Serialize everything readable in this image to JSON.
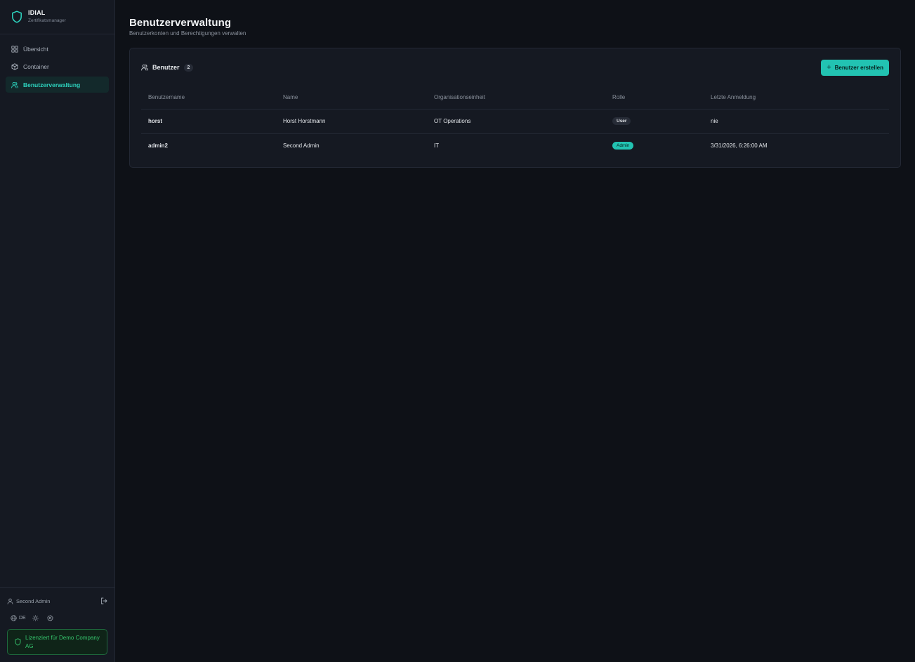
{
  "brand": {
    "name": "IDIAL",
    "subtitle": "Zertifikatsmanager",
    "accent": "#2dd4bf"
  },
  "sidebar": {
    "items": [
      {
        "label": "Übersicht",
        "icon": "grid-icon",
        "active": false
      },
      {
        "label": "Container",
        "icon": "box-icon",
        "active": false
      },
      {
        "label": "Benutzerverwaltung",
        "icon": "users-icon",
        "active": true
      }
    ],
    "footer": {
      "user_name": "Second Admin",
      "language": "DE",
      "license_text": "Lizenziert für Demo Company AG"
    }
  },
  "header": {
    "title": "Benutzerverwaltung",
    "subtitle": "Benutzerkonten und Berechtigungen verwalten"
  },
  "users_card": {
    "title": "Benutzer",
    "count": "2",
    "create_button": "Benutzer erstellen",
    "columns": [
      "Benutzername",
      "Name",
      "Organisationseinheit",
      "Rolle",
      "Letzte Anmeldung"
    ],
    "rows": [
      {
        "username": "horst",
        "name": "Horst Horstmann",
        "org_unit": "OT Operations",
        "role": "User",
        "last_login": "nie"
      },
      {
        "username": "admin2",
        "name": "Second Admin",
        "org_unit": "IT",
        "role": "Admin",
        "last_login": "3/31/2026, 6:26:00 AM"
      }
    ]
  },
  "colors": {
    "background": "#0e1117",
    "sidebar": "#151922",
    "accent": "#22c3b2",
    "license_green": "#35c46c"
  }
}
